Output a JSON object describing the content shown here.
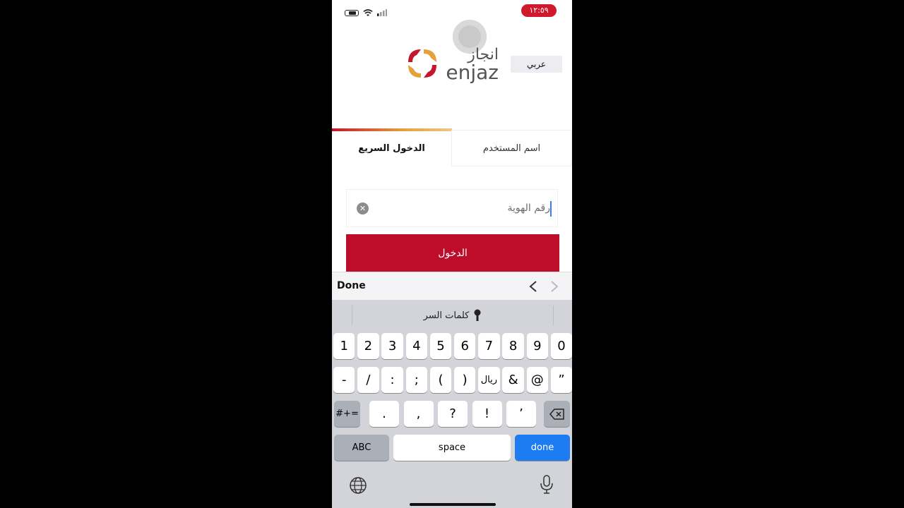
{
  "status": {
    "time": "١٢:٥٩"
  },
  "header": {
    "logo_arabic": "انجاز",
    "logo_latin": "enjaz",
    "language_button": "عربي"
  },
  "tabs": {
    "username_tab": "اسم المستخدم",
    "quick_login_tab": "الدخول السريع"
  },
  "login": {
    "id_placeholder": "رقم الهوية",
    "login_button": "الدخول"
  },
  "keyboard": {
    "accessory_done": "Done",
    "password_bar": "كلمات السر",
    "row1": [
      "1",
      "2",
      "3",
      "4",
      "5",
      "6",
      "7",
      "8",
      "9",
      "0"
    ],
    "row2": [
      "-",
      "/",
      ":",
      ";",
      "(",
      ")",
      "ريال",
      "&",
      "@",
      "”"
    ],
    "row3_mode": "#+=",
    "row3": [
      ".",
      ",",
      "?",
      "!",
      "’"
    ],
    "abc_key": "ABC",
    "space_key": "space",
    "done_key": "done"
  },
  "colors": {
    "accent": "#bd0d2b",
    "keyboard_blue": "#1e7cf2"
  }
}
